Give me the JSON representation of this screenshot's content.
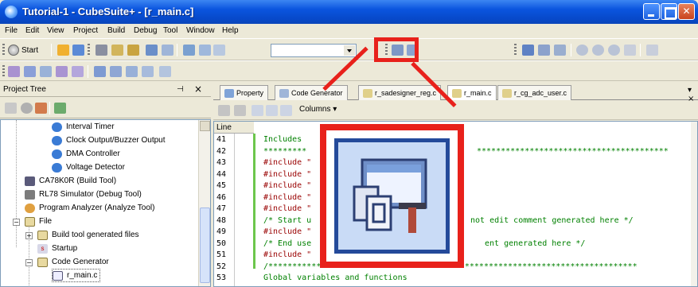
{
  "window": {
    "title": "Tutorial-1 - CubeSuite+ - [r_main.c]"
  },
  "menu": [
    "File",
    "Edit",
    "View",
    "Project",
    "Build",
    "Debug",
    "Tool",
    "Window",
    "Help"
  ],
  "toolbar": {
    "start_label": "Start"
  },
  "project_tree": {
    "title": "Project Tree",
    "items": [
      {
        "label": "Interval Timer",
        "icon": "peripheral-icon"
      },
      {
        "label": "Clock Output/Buzzer Output",
        "icon": "peripheral-icon"
      },
      {
        "label": "DMA Controller",
        "icon": "peripheral-icon"
      },
      {
        "label": "Voltage Detector",
        "icon": "peripheral-icon"
      },
      {
        "label": "CA78K0R (Build Tool)",
        "icon": "build-tool-icon"
      },
      {
        "label": "RL78 Simulator (Debug Tool)",
        "icon": "debug-tool-icon"
      },
      {
        "label": "Program Analyzer (Analyze Tool)",
        "icon": "analyze-tool-icon"
      },
      {
        "label": "File",
        "icon": "folder-icon"
      },
      {
        "label": "Build tool generated files",
        "icon": "folder-icon"
      },
      {
        "label": "Startup",
        "icon": "startup-icon"
      },
      {
        "label": "Code Generator",
        "icon": "folder-icon"
      },
      {
        "label": "r_main.c",
        "icon": "c-file-icon"
      }
    ]
  },
  "editor": {
    "tabs": [
      {
        "label": "Property",
        "active": false
      },
      {
        "label": "Code Generator",
        "active": false
      },
      {
        "label": "r_sadesigner_reg.c",
        "active": false
      },
      {
        "label": "r_main.c",
        "active": true
      },
      {
        "label": "r_cg_adc_user.c",
        "active": false
      }
    ],
    "columns_label": "Columns",
    "line_header": "Line",
    "lines": [
      {
        "num": "41",
        "text": "Includes",
        "kind": "comment"
      },
      {
        "num": "42",
        "text": "*********",
        "kind": "comment"
      },
      {
        "num": "43",
        "text": "#include \"",
        "kind": "pp"
      },
      {
        "num": "44",
        "text": "#include \"",
        "kind": "pp"
      },
      {
        "num": "45",
        "text": "#include \"",
        "kind": "pp"
      },
      {
        "num": "46",
        "text": "#include \"",
        "kind": "pp"
      },
      {
        "num": "47",
        "text": "#include \"",
        "kind": "pp"
      },
      {
        "num": "48",
        "text": "/* Start u",
        "kind": "comment"
      },
      {
        "num": "49",
        "text": "#include \"",
        "kind": "pp"
      },
      {
        "num": "50",
        "text": "/* End use",
        "kind": "comment"
      },
      {
        "num": "51",
        "text": "#include \"",
        "kind": "pp"
      },
      {
        "num": "52",
        "text": "/*****************************************************************************",
        "kind": "comment"
      },
      {
        "num": "53",
        "text": "Global variables and functions",
        "kind": "comment"
      }
    ],
    "right_fragments": [
      {
        "line": 0,
        "text": ""
      },
      {
        "line": 1,
        "text": "****************************************"
      },
      {
        "line": 7,
        "text": "not edit comment generated here */"
      },
      {
        "line": 9,
        "text": "ent generated here */"
      }
    ]
  },
  "colors": {
    "callout": "#e8211b",
    "title_bar": "#0a54de",
    "comment": "#008000",
    "preprocessor": "#990000"
  }
}
